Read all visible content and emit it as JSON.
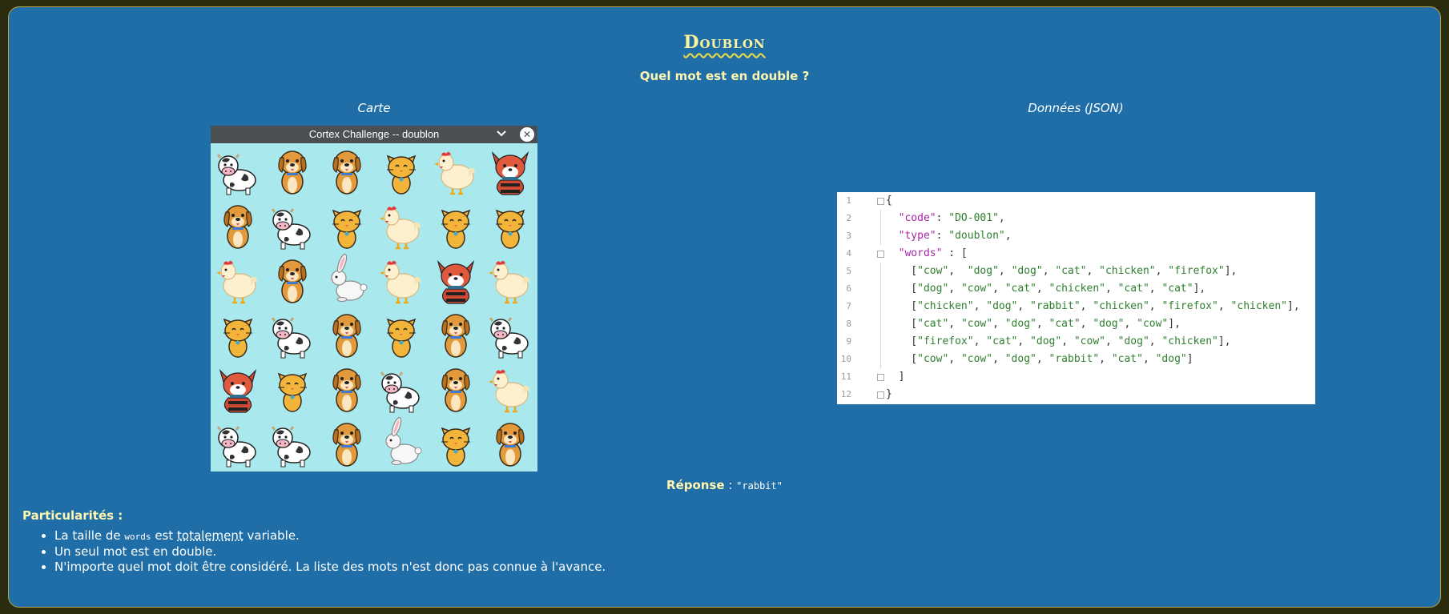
{
  "header": {
    "title": "Doublon",
    "subtitle": "Quel mot est en double ?"
  },
  "columns": {
    "left_label": "Carte",
    "right_label": "Données (JSON)"
  },
  "game_window": {
    "title": "Cortex Challenge -- doublon",
    "grid": [
      [
        "cow",
        "dog",
        "dog",
        "cat",
        "chicken",
        "firefox"
      ],
      [
        "dog",
        "cow",
        "cat",
        "chicken",
        "cat",
        "cat"
      ],
      [
        "chicken",
        "dog",
        "rabbit",
        "chicken",
        "firefox",
        "chicken"
      ],
      [
        "cat",
        "cow",
        "dog",
        "cat",
        "dog",
        "cow"
      ],
      [
        "firefox",
        "cat",
        "dog",
        "cow",
        "dog",
        "chicken"
      ],
      [
        "cow",
        "cow",
        "dog",
        "rabbit",
        "cat",
        "dog"
      ]
    ],
    "colors": {
      "background": "#a9e9ed",
      "titlebar": "#4b4f54"
    }
  },
  "code_editor": {
    "line_numbers": [
      "1",
      "2",
      "3",
      "4",
      "5",
      "6",
      "7",
      "8",
      "9",
      "10",
      "11",
      "12"
    ],
    "lines": [
      "{",
      "  \"code\": \"DO-001\",",
      "  \"type\": \"doublon\",",
      "  \"words\" : [",
      "    [\"cow\",  \"dog\", \"dog\", \"cat\", \"chicken\", \"firefox\"],",
      "    [\"dog\", \"cow\", \"cat\", \"chicken\", \"cat\", \"cat\"],",
      "    [\"chicken\", \"dog\", \"rabbit\", \"chicken\", \"firefox\", \"chicken\"],",
      "    [\"cat\", \"cow\", \"dog\", \"cat\", \"dog\", \"cow\"],",
      "    [\"firefox\", \"cat\", \"dog\", \"cow\", \"dog\", \"chicken\"],",
      "    [\"cow\", \"cow\", \"dog\", \"rabbit\", \"cat\", \"dog\"]",
      "  ]",
      "}"
    ]
  },
  "answer": {
    "label": "Réponse",
    "separator": " : ",
    "value": "\"rabbit\""
  },
  "features": {
    "title": "Particularités :",
    "items": [
      {
        "before": "La taille de ",
        "code": "words",
        "middle": " est ",
        "emph": "totalement",
        "after": " variable."
      },
      {
        "text": "Un seul mot est en double."
      },
      {
        "text": "N'importe quel mot doit être considéré. La liste des mots n'est donc pas connue à l'avance."
      }
    ]
  },
  "colors": {
    "panel": "#1f6ea7",
    "page_background": "#2b2b10",
    "accent_yellow": "#fff59c",
    "json_key": "#a626a4",
    "json_string": "#2f7f2f"
  }
}
